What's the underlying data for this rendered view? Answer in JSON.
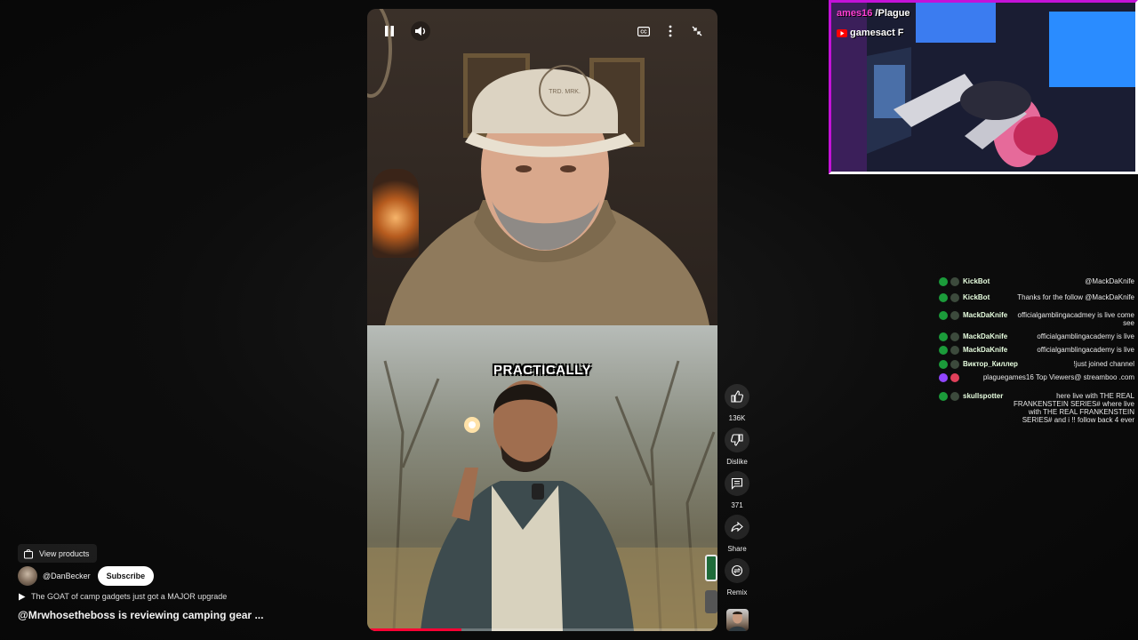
{
  "video": {
    "caption": "PRACTICALLY",
    "progress_fraction": 0.27,
    "controls": {
      "pause_icon": "pause-icon",
      "volume_icon": "volume-icon",
      "captions_icon": "captions-icon",
      "more_icon": "more-vert-icon",
      "exit_fullscreen_icon": "collapse-icon"
    }
  },
  "actions": {
    "like_count": "136K",
    "dislike_label": "Dislike",
    "comments_count": "371",
    "share_label": "Share",
    "remix_label": "Remix"
  },
  "info": {
    "view_products_label": "View products",
    "channel_handle": "@DanBecker",
    "subscribe_label": "Subscribe",
    "description": "The GOAT of camp gadgets just got a MAJOR upgrade",
    "title": "@Mrwhosetheboss is reviewing camping gear ..."
  },
  "overlay": {
    "cam_line1_a": "ames16",
    "cam_line1_b": " /Plague",
    "cam_line2": "gamesact F",
    "border_color": "#c312d8"
  },
  "chat": [
    {
      "name": "KickBot",
      "msg": "@MackDaKnife",
      "platform": "kick"
    },
    {
      "name": "KickBot",
      "msg": "Thanks for the follow @MackDaKnife",
      "platform": "kick"
    },
    {
      "name": "MackDaKnife",
      "msg": "officialgamblingacadmey is live come see",
      "platform": "kick"
    },
    {
      "name": "MackDaKnife",
      "msg": "officialgamblingacademy is live",
      "platform": "kick"
    },
    {
      "name": "MackDaKnife",
      "msg": "officialgamblingacademy is live",
      "platform": "kick"
    },
    {
      "name": "Виктор_Киллер",
      "msg": "!just joined channel",
      "platform": "kick"
    },
    {
      "name": "",
      "msg": "plaguegames16 Top Viewers@ streamboo .com",
      "platform": "twitch"
    },
    {
      "name": "skullspotter",
      "msg": "here live with THE REAL FRANKENSTEIN SERIES# where live with THE REAL FRANKENSTEIN SERIES# and i !! follow back 4 ever",
      "platform": "kick"
    }
  ]
}
